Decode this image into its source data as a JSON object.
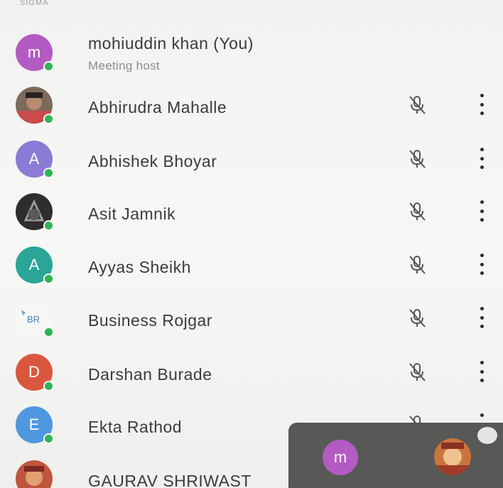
{
  "header": {
    "cut_label": "SIGMA"
  },
  "participants": [
    {
      "name": "mohiuddin khan (You)",
      "subtitle": "Meeting host",
      "initial": "m",
      "color": "#b45ac3"
    },
    {
      "name": "Abhirudra Mahalle",
      "initial": "",
      "color": "#8a6a55"
    },
    {
      "name": "Abhishek Bhoyar",
      "initial": "A",
      "color": "#8c7bd6"
    },
    {
      "name": "Asit Jamnik",
      "initial": "",
      "color": "#3a3838"
    },
    {
      "name": "Ayyas Sheikh",
      "initial": "A",
      "color": "#2aa598"
    },
    {
      "name": "Business Rojgar",
      "initial": "",
      "color": "#ffffff"
    },
    {
      "name": "Darshan Burade",
      "initial": "D",
      "color": "#d9573e"
    },
    {
      "name": "Ekta Rathod",
      "initial": "E",
      "color": "#4f97de"
    },
    {
      "name": "GAURAV SHRIWAST",
      "initial": "",
      "color": "#c0553e"
    }
  ],
  "pip": {
    "self_initial": "m",
    "self_color": "#b45ac3"
  },
  "icons": {
    "muted": "mic-off-icon",
    "more": "more-vert-icon",
    "online": "online-dot"
  }
}
